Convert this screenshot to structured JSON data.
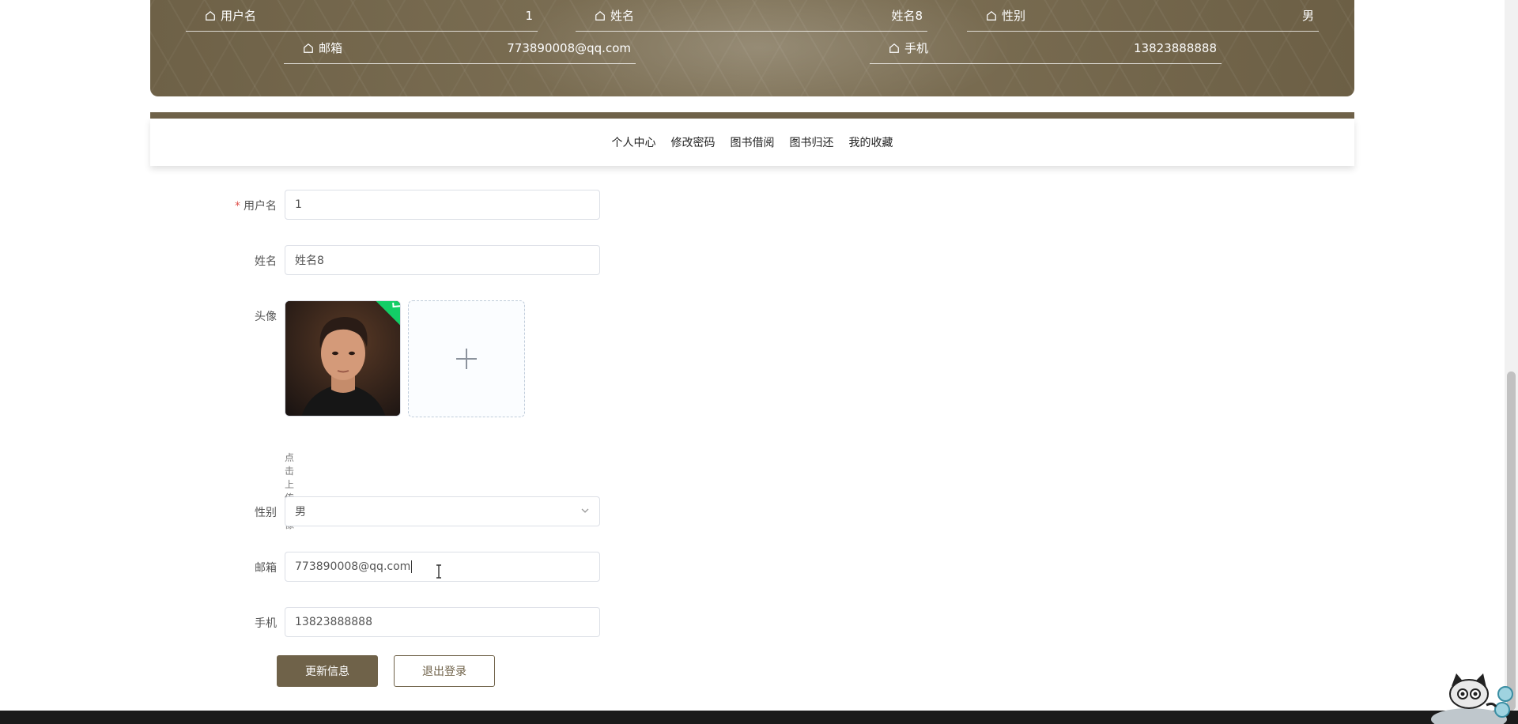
{
  "banner": {
    "items": [
      {
        "label": "用户名",
        "value": "1"
      },
      {
        "label": "姓名",
        "value": "姓名8"
      },
      {
        "label": "性别",
        "value": "男"
      },
      {
        "label": "邮箱",
        "value": "773890008@qq.com"
      },
      {
        "label": "手机",
        "value": "13823888888"
      }
    ]
  },
  "nav": {
    "items": [
      "个人中心",
      "修改密码",
      "图书借阅",
      "图书归还",
      "我的收藏"
    ]
  },
  "form": {
    "username_label": "用户名",
    "username_value": "1",
    "name_label": "姓名",
    "name_value": "姓名8",
    "avatar_label": "头像",
    "upload_hint": "点击上传头像",
    "gender_label": "性别",
    "gender_value": "男",
    "email_label": "邮箱",
    "email_value": "773890008@qq.com",
    "phone_label": "手机",
    "phone_value": "13823888888",
    "update_button": "更新信息",
    "logout_button": "退出登录"
  },
  "colors": {
    "brand": "#6f6249",
    "required": "#e0524d",
    "success": "#13ce66"
  },
  "icons": {
    "info_item_icon": "home-icon",
    "select_icon": "chevron-down-icon",
    "upload_icon": "plus-icon",
    "uploaded_badge_icon": "check-icon",
    "cursor_icon": "text-cursor-icon"
  }
}
